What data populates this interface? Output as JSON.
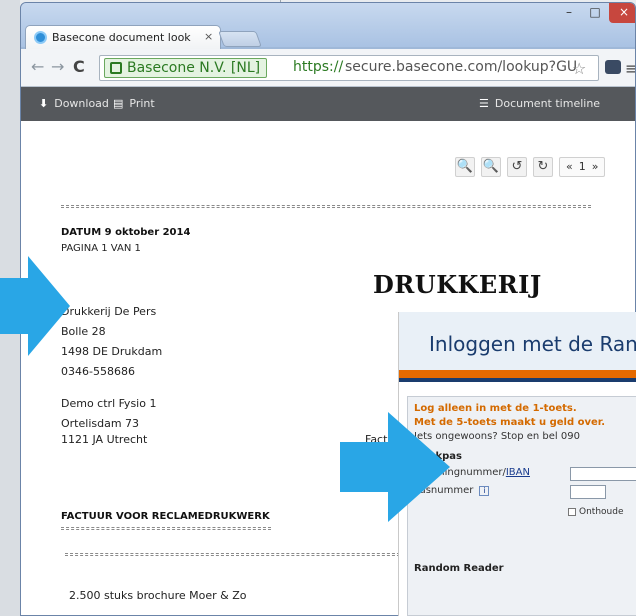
{
  "browser": {
    "tab_title": "Basecone document look",
    "tab_close": "×",
    "win_min": "–",
    "win_max": "□",
    "win_close": "×",
    "nav_back": "←",
    "nav_fwd": "→",
    "nav_reload": "C",
    "ev_label": "Basecone N.V. [NL]",
    "url_scheme": "https://",
    "url_rest": "secure.basecone.com/lookup?GU",
    "star": "☆",
    "menu": "≡"
  },
  "viewer": {
    "download_label": "Download",
    "print_label": "Print",
    "timeline_label": "Document timeline",
    "download_glyph": "⬇",
    "print_glyph": "▤",
    "timeline_glyph": "☰",
    "tools": [
      "🔍",
      "🔍",
      "↺",
      "↻"
    ],
    "page_prev": "«",
    "page_num": "1",
    "page_next": "»"
  },
  "document": {
    "datum": "DATUM 9 oktober 2014",
    "pagina": "PAGINA 1 VAN 1",
    "title": "DRUKKERIJ",
    "addr_lines": [
      "Drukkerij De Pers",
      "Bolle 28",
      "1498 DE Drukdam",
      "0346-558686"
    ],
    "recipient_lines": [
      "Demo ctrl Fysio 1",
      "Ortelisdam 73",
      "1121 JA Utrecht"
    ],
    "factuur_partial": "Factu",
    "section_title": "FACTUUR VOOR RECLAMEDRUKWERK",
    "item_line": "2.500 stuks brochure Moer & Zo"
  },
  "login": {
    "title": "Inloggen met de Rando",
    "warn1": "Log alleen in met de 1-toets.",
    "warn2": "Met de 5-toets maakt u geld over.",
    "warn3": "Iets ongewoons? Stop en bel 090",
    "bankpas_label": "Bankpas",
    "rekening_label": "Rekeningnummer/",
    "rekening_link": "IBAN",
    "pas_label": "Pasnummer",
    "info": "i",
    "onthoud": "Onthoude",
    "reader_label": "Random Reader"
  },
  "colors": {
    "arrow": "#29a6e6",
    "viewer_bar": "#55585c",
    "login_orange": "#e56a00",
    "login_navy": "#1a3c6e"
  }
}
